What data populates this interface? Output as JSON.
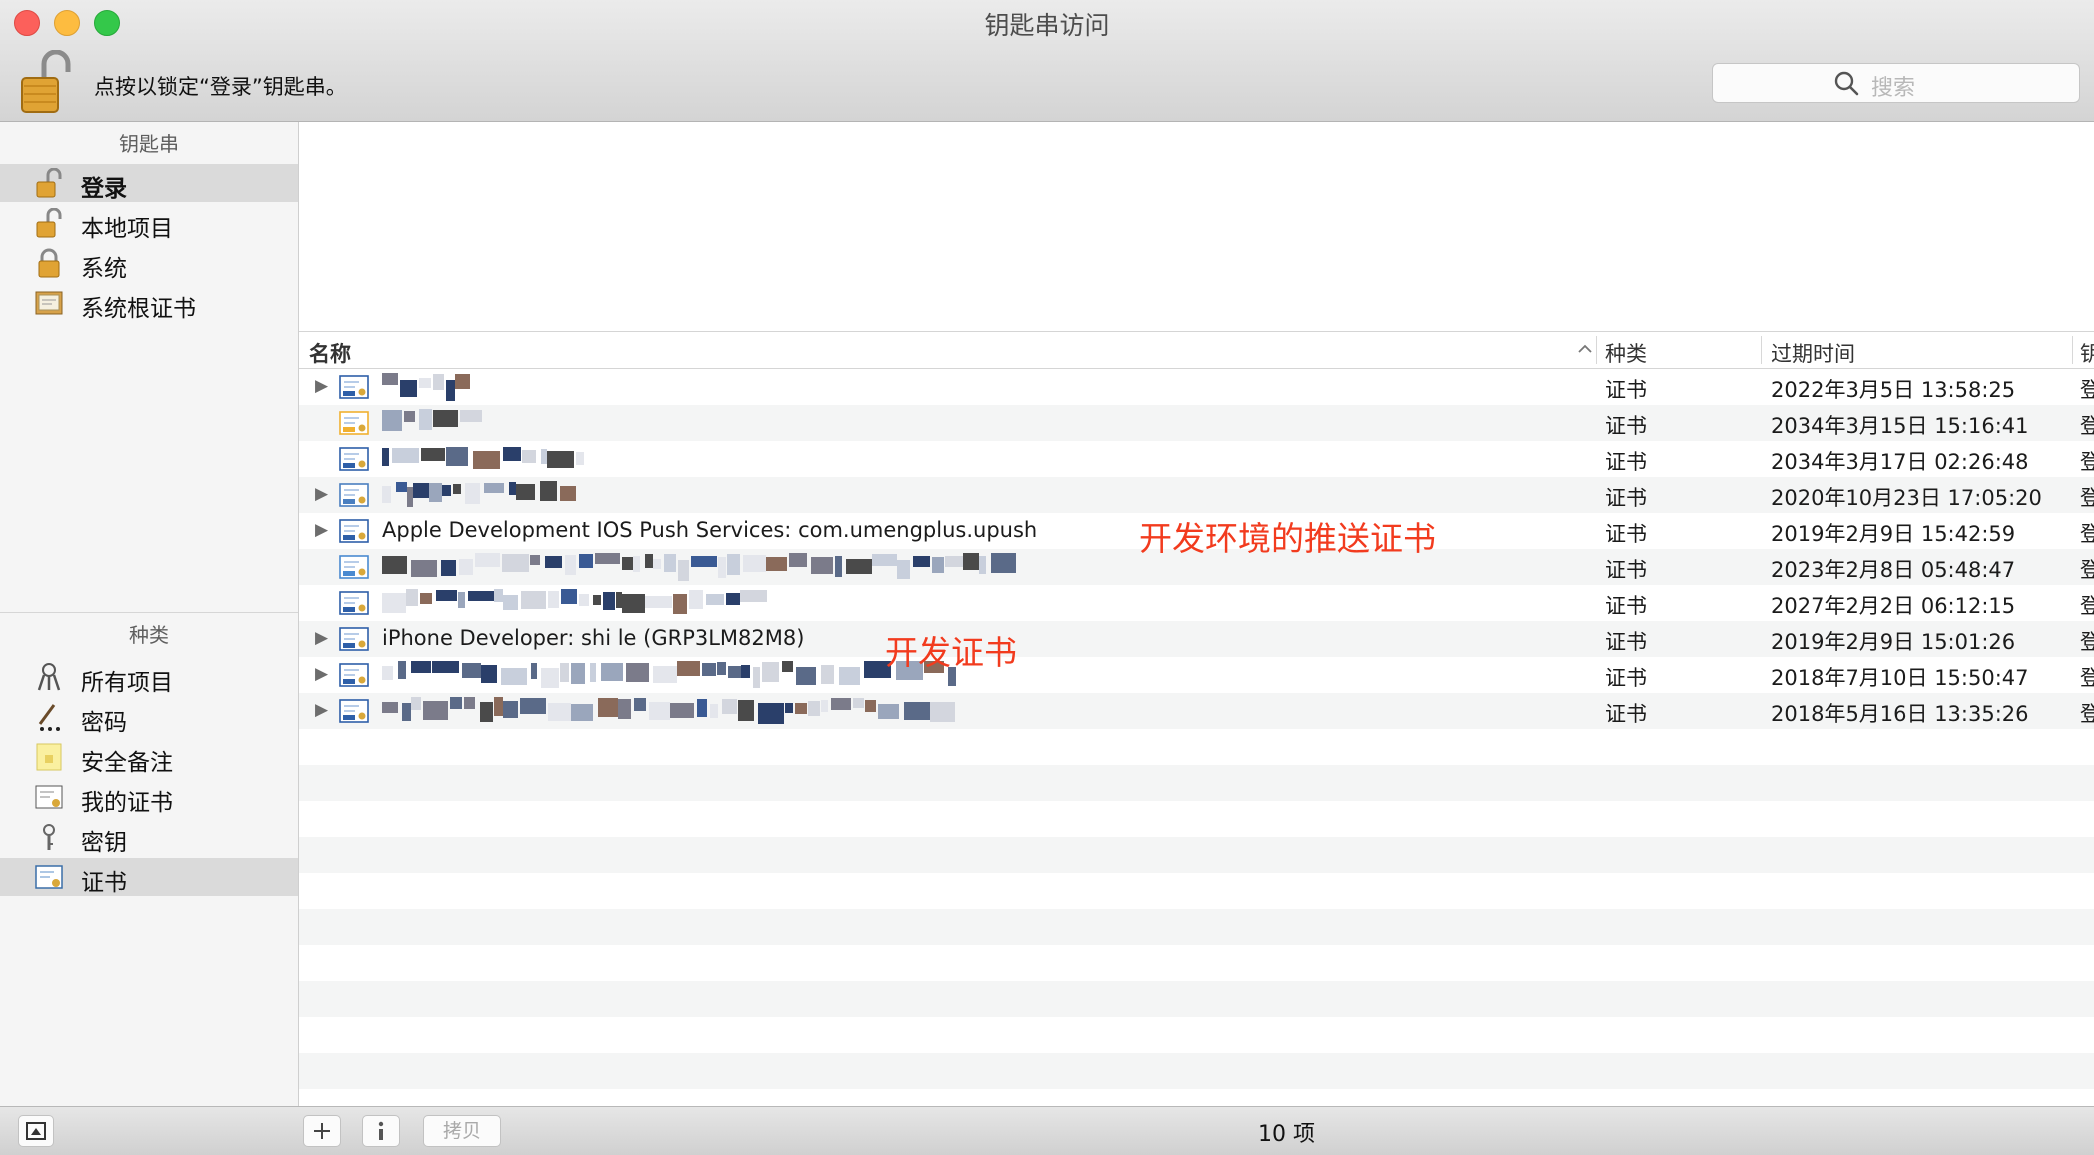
{
  "window": {
    "title": "钥匙串访问"
  },
  "toolbar": {
    "lock_message": "点按以锁定“登录”钥匙串。",
    "search_placeholder": "搜索"
  },
  "sidebar": {
    "keychains_header": "钥匙串",
    "keychains": [
      {
        "label": "登录",
        "icon": "unlocked-padlock-icon",
        "selected": true
      },
      {
        "label": "本地项目",
        "icon": "unlocked-padlock-icon",
        "selected": false
      },
      {
        "label": "系统",
        "icon": "locked-padlock-icon",
        "selected": false
      },
      {
        "label": "系统根证书",
        "icon": "certificate-cabinet-icon",
        "selected": false
      }
    ],
    "category_header": "种类",
    "categories": [
      {
        "label": "所有项目",
        "icon": "all-items-icon",
        "selected": false
      },
      {
        "label": "密码",
        "icon": "password-pen-icon",
        "selected": false
      },
      {
        "label": "安全备注",
        "icon": "secure-note-icon",
        "selected": false
      },
      {
        "label": "我的证书",
        "icon": "my-certificate-icon",
        "selected": false
      },
      {
        "label": "密钥",
        "icon": "key-icon",
        "selected": false
      },
      {
        "label": "证书",
        "icon": "certificate-icon",
        "selected": true
      }
    ]
  },
  "table": {
    "columns": [
      "名称",
      "种类",
      "过期时间",
      "钥"
    ],
    "rows": [
      {
        "name": "",
        "kind": "证书",
        "expires": "2022年3月5日 13:58:25",
        "keychain": "登录"
      },
      {
        "name": "",
        "kind": "证书",
        "expires": "2034年3月15日 15:16:41",
        "keychain": "登录"
      },
      {
        "name": "",
        "kind": "证书",
        "expires": "2034年3月17日 02:26:48",
        "keychain": "登录"
      },
      {
        "name": "",
        "kind": "证书",
        "expires": "2020年10月23日 17:05:20",
        "keychain": "登录"
      },
      {
        "name": "Apple Development IOS Push Services: com.umengplus.upush",
        "kind": "证书",
        "expires": "2019年2月9日 15:42:59",
        "keychain": "登录"
      },
      {
        "name": "",
        "kind": "证书",
        "expires": "2023年2月8日 05:48:47",
        "keychain": "登录"
      },
      {
        "name": "",
        "kind": "证书",
        "expires": "2027年2月2日 06:12:15",
        "keychain": "登录"
      },
      {
        "name": "iPhone Developer: shi le (GRP3LM82M8)",
        "kind": "证书",
        "expires": "2019年2月9日 15:01:26",
        "keychain": "登录"
      },
      {
        "name": "",
        "kind": "证书",
        "expires": "2018年7月10日 15:50:47",
        "keychain": "登录"
      },
      {
        "name": "",
        "kind": "证书",
        "expires": "2018年5月16日 13:35:26",
        "keychain": "登录"
      }
    ]
  },
  "annotations": {
    "push_cert": "开发环境的推送证书",
    "dev_cert": "开发证书"
  },
  "footer": {
    "copy_label": "拷贝",
    "item_count": "10 项"
  },
  "colors": {
    "annotation": "#f23b1e",
    "selection": "#dadada",
    "row_alt": "#f4f5f5"
  }
}
